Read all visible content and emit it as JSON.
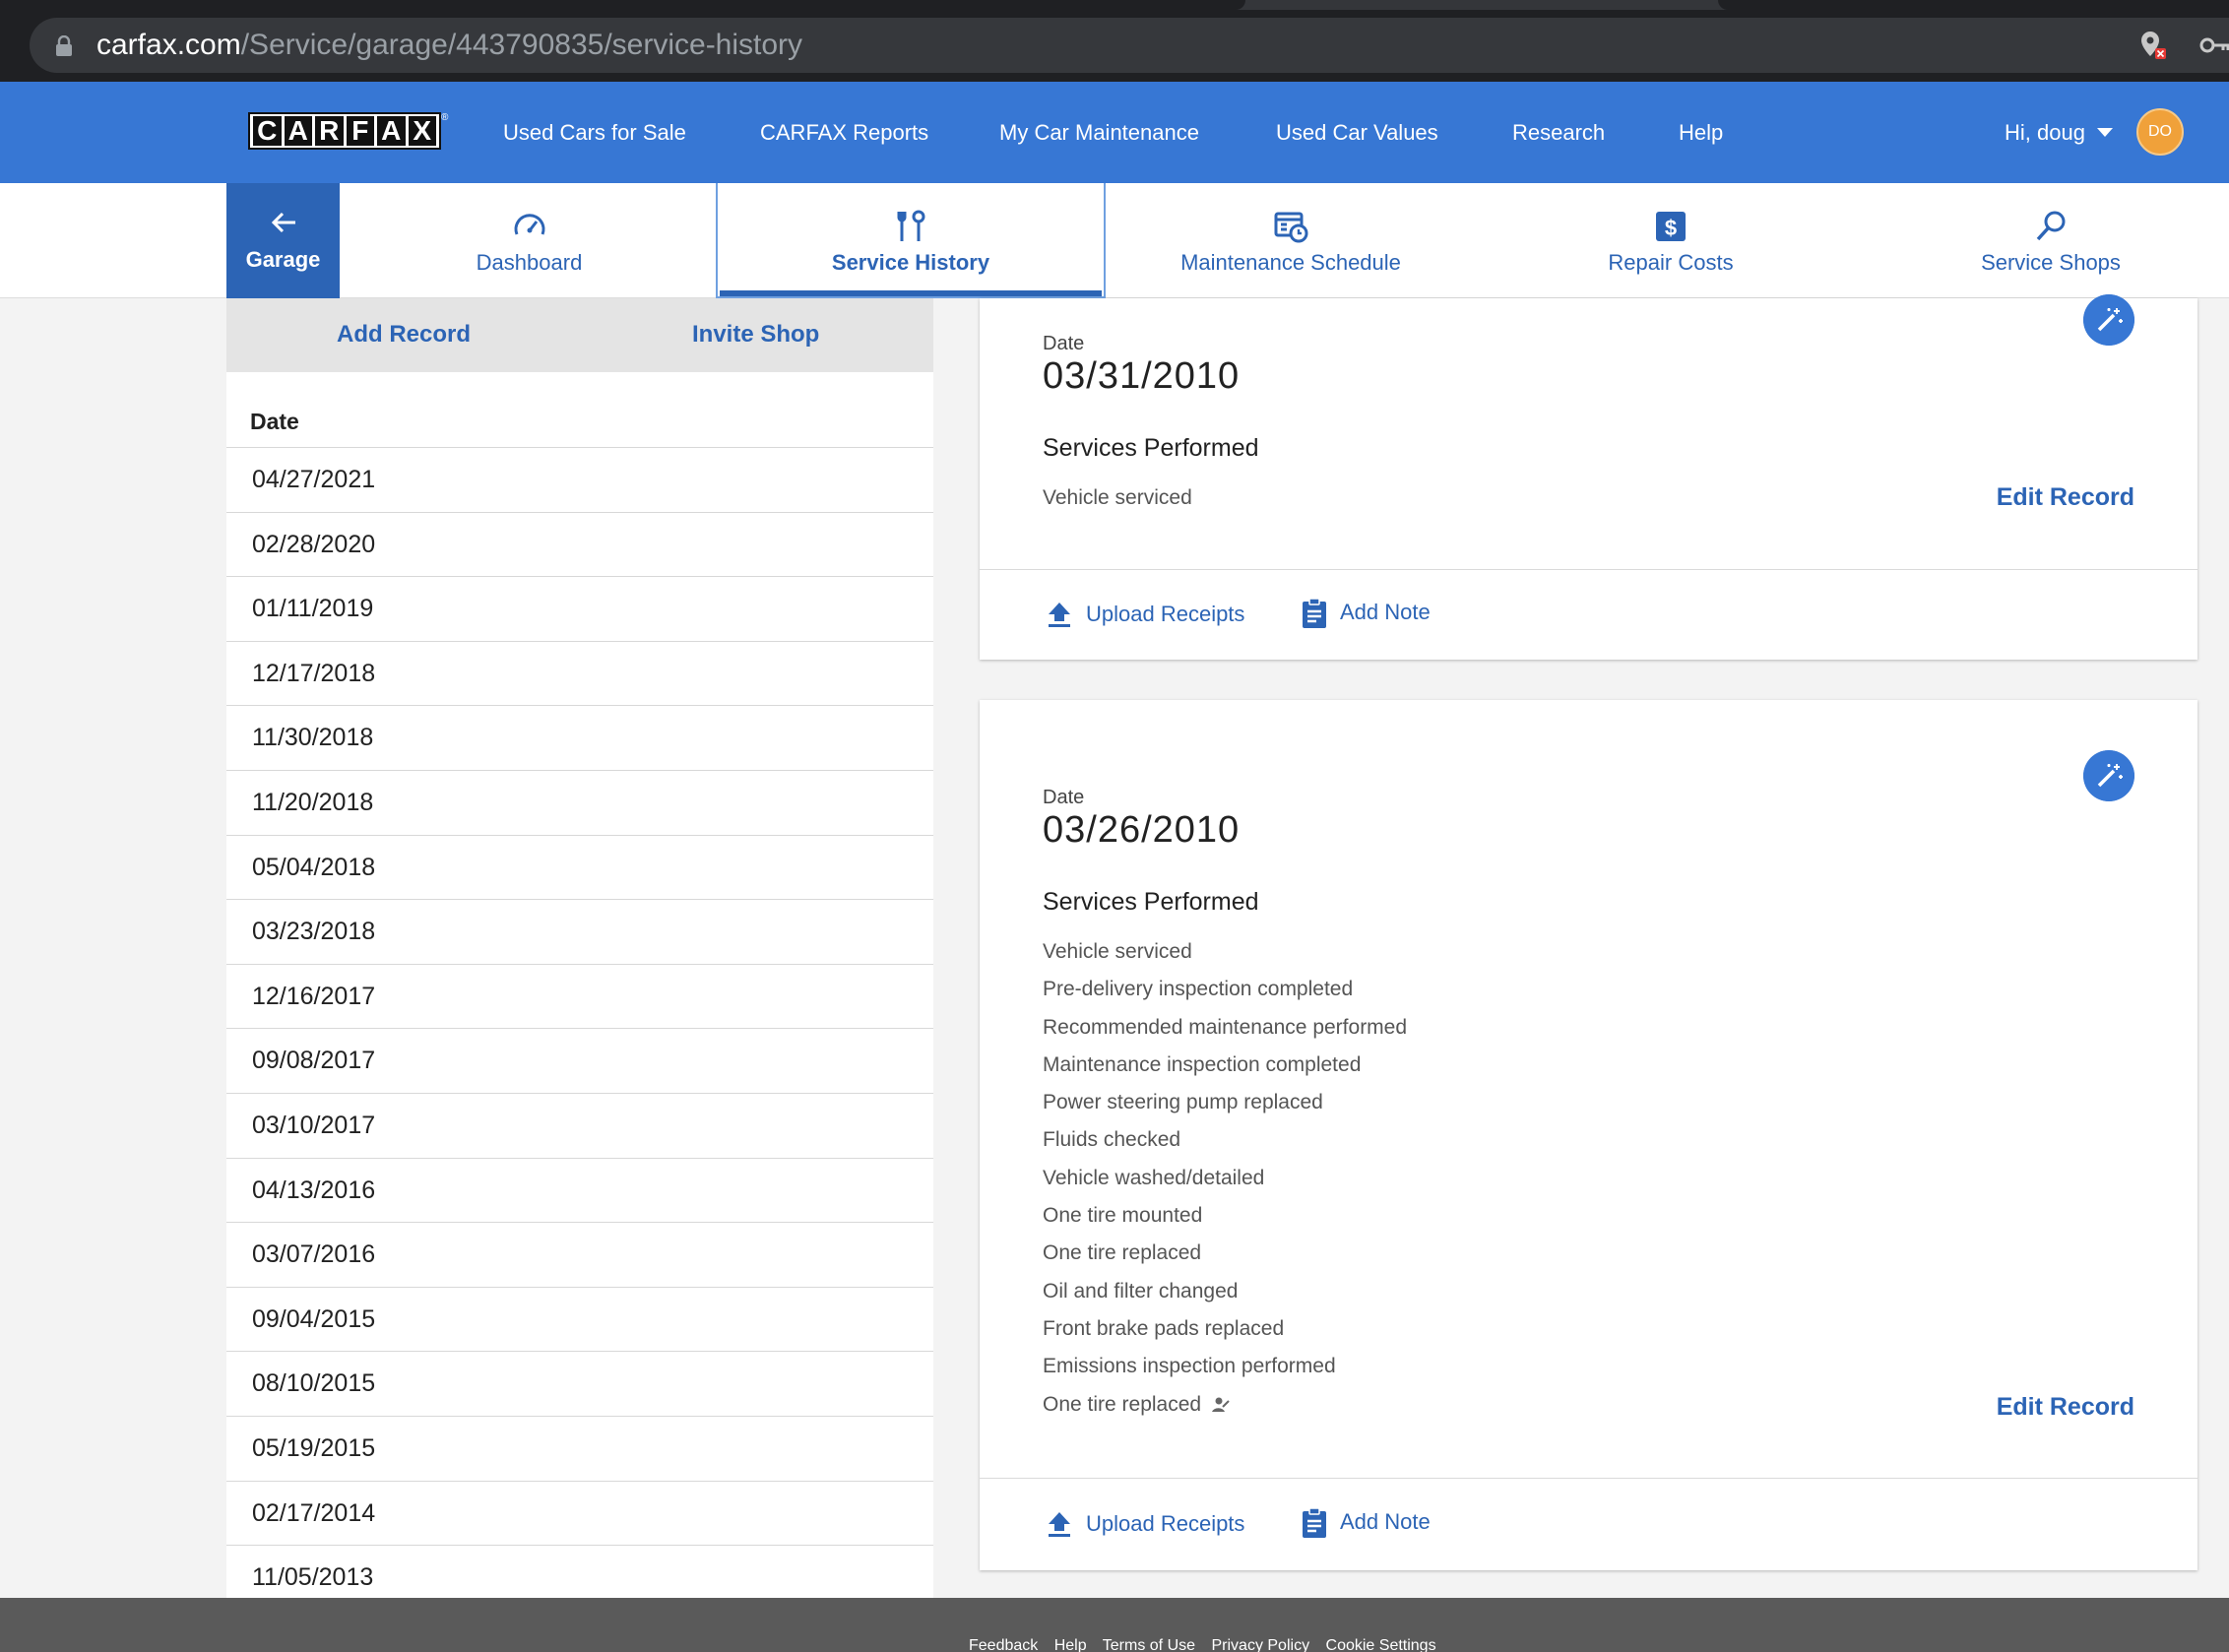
{
  "browser": {
    "url_domain": "carfax.com",
    "url_path": "/Service/garage/443790835/service-history"
  },
  "topnav": {
    "logo_letters": [
      "C",
      "A",
      "R",
      "F",
      "A",
      "X"
    ],
    "links": [
      "Used Cars for Sale",
      "CARFAX Reports",
      "My Car Maintenance",
      "Used Car Values",
      "Research",
      "Help"
    ],
    "greeting": "Hi, doug",
    "avatar_initials": "DO"
  },
  "subnav": {
    "back_label": "Garage",
    "tabs": [
      {
        "label": "Dashboard",
        "icon": "speedometer-icon"
      },
      {
        "label": "Service History",
        "icon": "tools-icon",
        "active": true
      },
      {
        "label": "Maintenance Schedule",
        "icon": "calendar-clock-icon"
      },
      {
        "label": "Repair Costs",
        "icon": "dollar-icon"
      },
      {
        "label": "Service Shops",
        "icon": "search-icon"
      }
    ]
  },
  "left_panel": {
    "add_record": "Add Record",
    "invite_shop": "Invite Shop",
    "date_header": "Date",
    "dates": [
      "04/27/2021",
      "02/28/2020",
      "01/11/2019",
      "12/17/2018",
      "11/30/2018",
      "11/20/2018",
      "05/04/2018",
      "03/23/2018",
      "12/16/2017",
      "09/08/2017",
      "03/10/2017",
      "04/13/2016",
      "03/07/2016",
      "09/04/2015",
      "08/10/2015",
      "05/19/2015",
      "02/17/2014",
      "11/05/2013"
    ]
  },
  "records": [
    {
      "date_label": "Date",
      "date": "03/31/2010",
      "services_title": "Services Performed",
      "services": [
        "Vehicle serviced"
      ],
      "edit_label": "Edit Record",
      "upload_label": "Upload Receipts",
      "note_label": "Add Note"
    },
    {
      "date_label": "Date",
      "date": "03/26/2010",
      "services_title": "Services Performed",
      "services": [
        "Vehicle serviced",
        "Pre-delivery inspection completed",
        "Recommended maintenance performed",
        "Maintenance inspection completed",
        "Power steering pump replaced",
        "Fluids checked",
        "Vehicle washed/detailed",
        "One tire mounted",
        "One tire replaced",
        "Oil and filter changed",
        "Front brake pads replaced",
        "Emissions inspection performed",
        "One tire replaced"
      ],
      "edit_label": "Edit Record",
      "upload_label": "Upload Receipts",
      "note_label": "Add Note"
    }
  ],
  "footer": {
    "links": [
      "Feedback",
      "Help",
      "Terms of Use",
      "Privacy Policy",
      "Cookie Settings"
    ]
  },
  "colors": {
    "brand_blue": "#3777d4",
    "link_blue": "#2c64b5",
    "avatar_orange": "#f0a13a"
  }
}
